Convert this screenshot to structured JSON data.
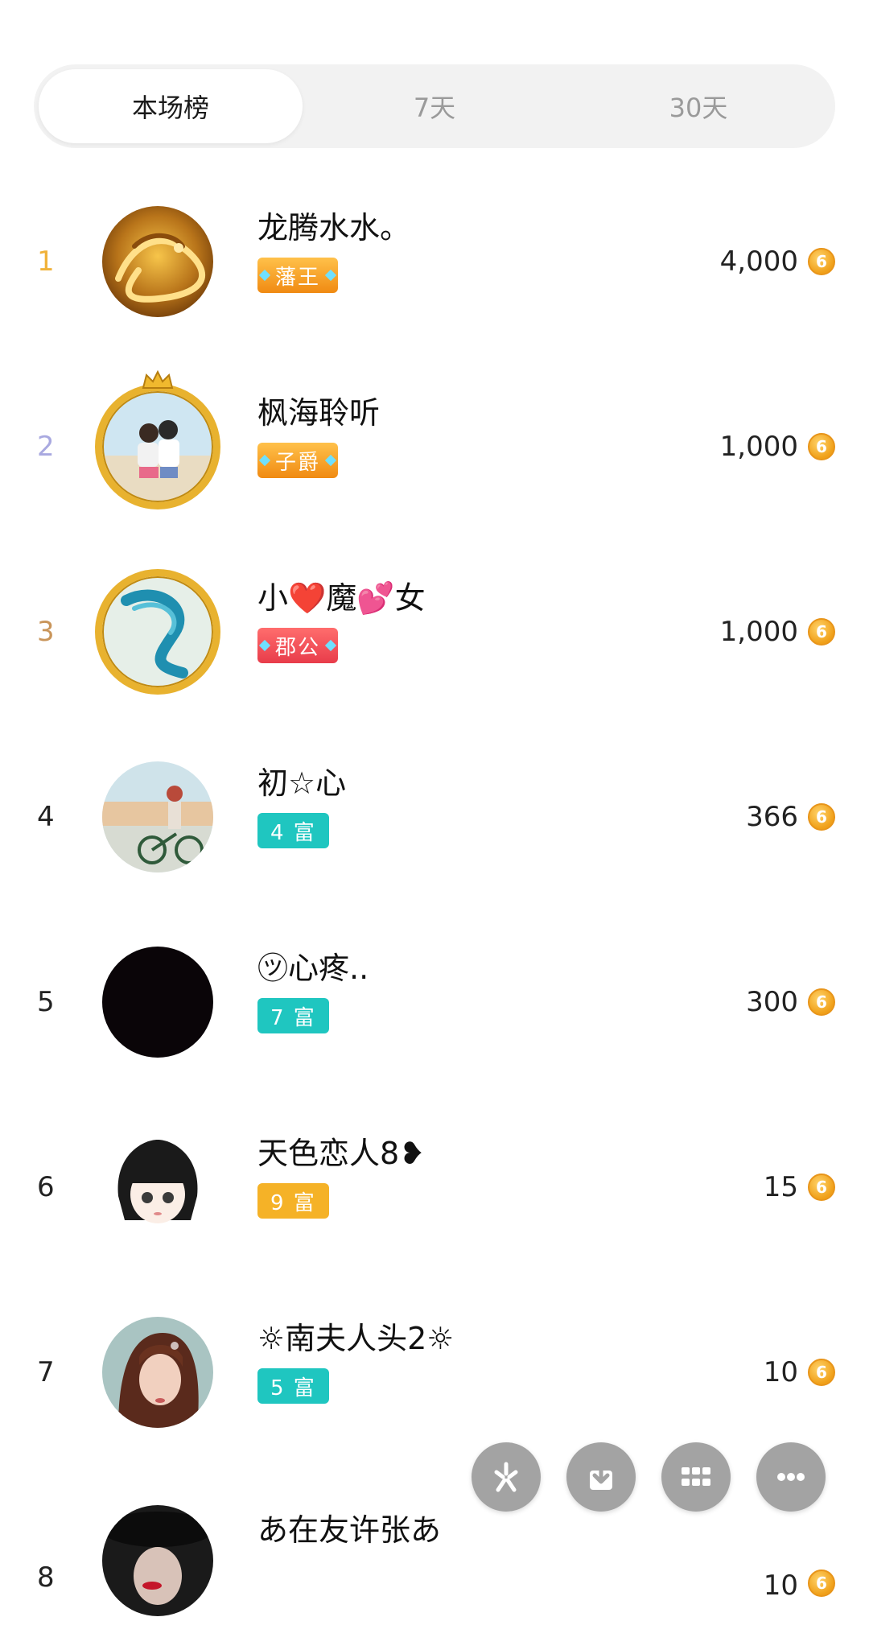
{
  "tabs": [
    {
      "label": "本场榜",
      "active": true
    },
    {
      "label": "7天",
      "active": false
    },
    {
      "label": "30天",
      "active": false
    }
  ],
  "ranking": [
    {
      "rank": "1",
      "name": "龙腾水水。",
      "badge": "藩王",
      "amount": "4,000"
    },
    {
      "rank": "2",
      "name": "枫海聆听",
      "badge": "子爵",
      "amount": "1,000"
    },
    {
      "rank": "3",
      "name": "小❤️魔💕女",
      "badge": "郡公",
      "amount": "1,000"
    },
    {
      "rank": "4",
      "name": "初☆心",
      "badge": "4 富",
      "amount": "366"
    },
    {
      "rank": "5",
      "name": "㋡心疼..",
      "badge": "7 富",
      "amount": "300"
    },
    {
      "rank": "6",
      "name": "天色恋人8❥",
      "badge": "9 富",
      "amount": "15"
    },
    {
      "rank": "7",
      "name": "☼南夫人头2☼",
      "badge": "5 富",
      "amount": "10"
    },
    {
      "rank": "8",
      "name": "あ在友许张あ",
      "badge": "",
      "amount": "10"
    }
  ],
  "coin_symbol": "6",
  "colors": {
    "rank1": "#f0b23a",
    "rank2": "#a9a9e0",
    "rank3": "#c9955a",
    "level_teal": "#1fc6c0",
    "level_gold": "#f5b227",
    "fab_gray": "#a3a3a3"
  },
  "fab_icons": [
    "sparkle-icon",
    "download-icon",
    "grid-icon",
    "more-icon"
  ]
}
